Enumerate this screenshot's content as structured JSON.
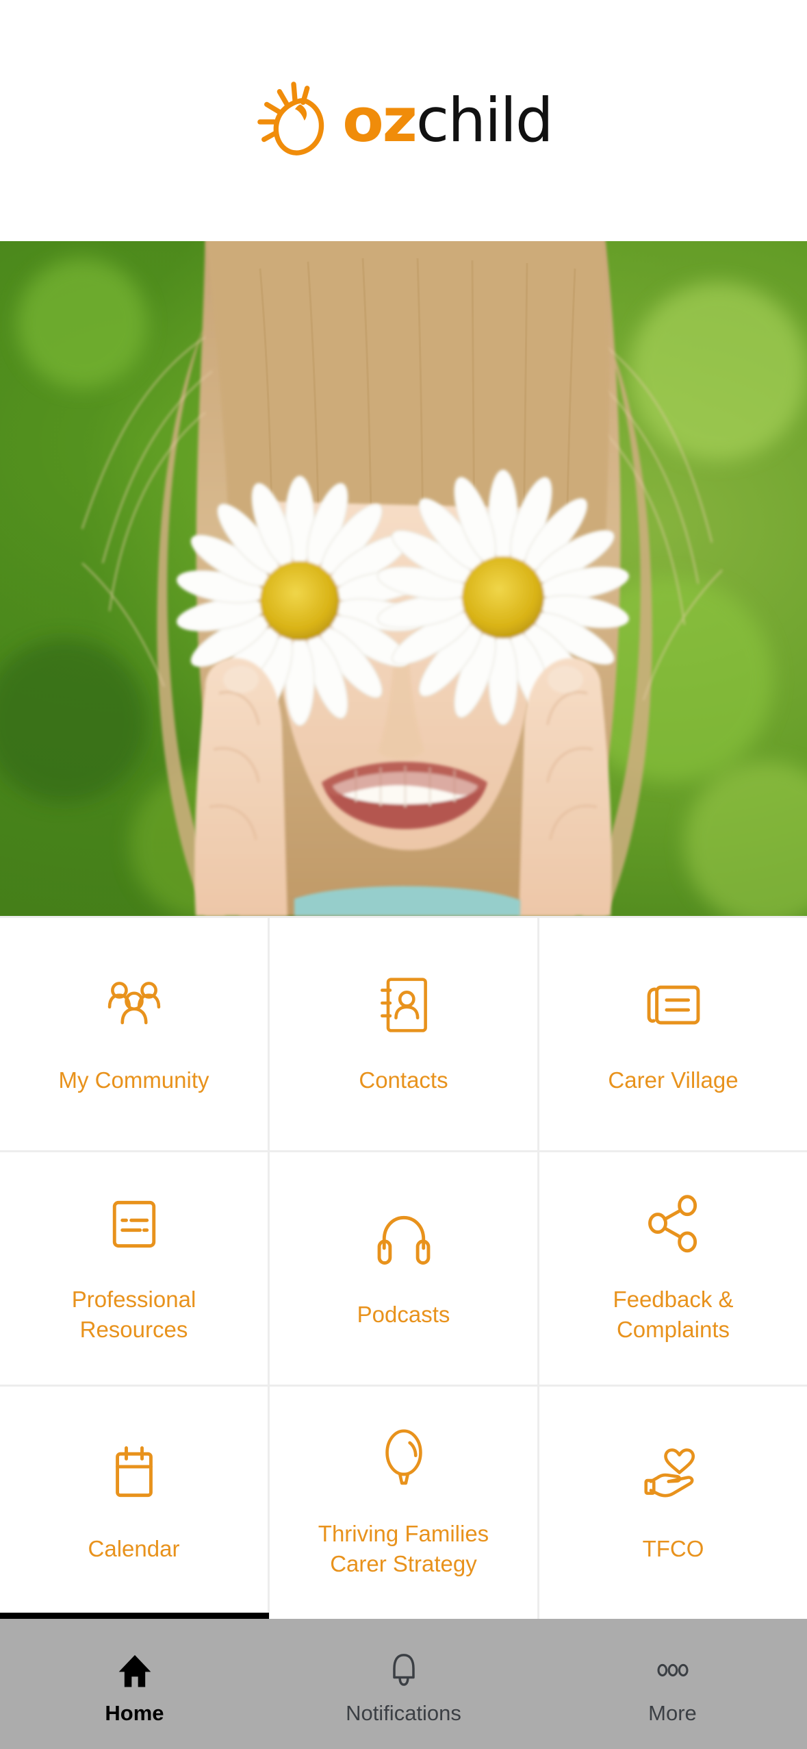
{
  "header": {
    "logo": {
      "icon": "ozchild-sun-icon",
      "text_primary": "oz",
      "text_secondary": "child",
      "primary_color": "#F08C0A",
      "secondary_color": "#111111"
    }
  },
  "hero": {
    "alt": "young girl holding two daisies over her eyes in a green field",
    "icon": "hero-photo"
  },
  "theme": {
    "accent": "#E8921C",
    "tabbar_bg": "#ACACAC",
    "tile_bg": "#FFFFFF",
    "divider": "#EDEDED",
    "indicator": "#000000"
  },
  "grid": {
    "tiles": [
      {
        "label": "My Community",
        "icon": "community-people-icon"
      },
      {
        "label": "Contacts",
        "icon": "contact-book-icon"
      },
      {
        "label": "Carer Village",
        "icon": "newspaper-article-icon"
      },
      {
        "label": "Professional\nResources",
        "line1": "Professional",
        "line2": "Resources",
        "icon": "document-lines-icon"
      },
      {
        "label": "Podcasts",
        "icon": "headphones-icon"
      },
      {
        "label": "Feedback &\nComplaints",
        "line1": "Feedback &",
        "line2": "Complaints",
        "icon": "share-nodes-icon"
      },
      {
        "label": "Calendar",
        "icon": "calendar-icon"
      },
      {
        "label": "Thriving Families\nCarer Strategy",
        "line1": "Thriving Families",
        "line2": "Carer Strategy",
        "icon": "balloon-icon"
      },
      {
        "label": "TFCO",
        "icon": "hand-heart-icon"
      }
    ]
  },
  "tabbar": {
    "items": [
      {
        "label": "Home",
        "icon": "home-icon",
        "active": true
      },
      {
        "label": "Notifications",
        "icon": "bell-icon",
        "active": false
      },
      {
        "label": "More",
        "icon": "more-dots-icon",
        "active": false
      }
    ]
  }
}
